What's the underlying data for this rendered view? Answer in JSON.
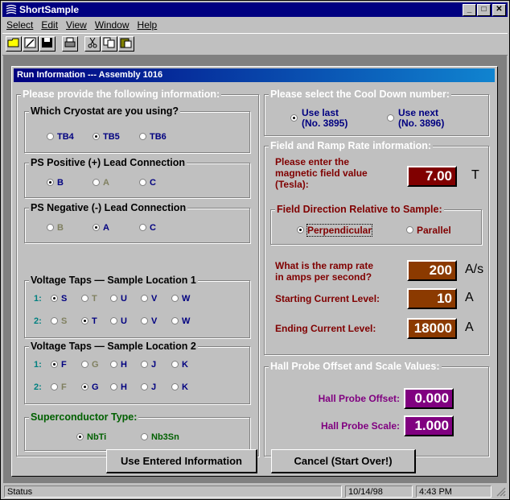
{
  "app": {
    "title": "ShortSample",
    "min_btn": "_",
    "max_btn": "□",
    "close_btn": "✕"
  },
  "menu": {
    "items": [
      "Select",
      "Edit",
      "View",
      "Window",
      "Help"
    ]
  },
  "toolbar": {
    "icons": [
      "open-folder-icon",
      "edit-icon",
      "save-icon",
      "print-icon",
      "cut-icon",
      "copy-icon",
      "paste-icon"
    ]
  },
  "dialog": {
    "title": "Run Information --- Assembly 1016",
    "left_header": "Please provide the following information:",
    "cryostat": {
      "label": "Which Cryostat are you using?",
      "options": [
        "TB4",
        "TB5",
        "TB6"
      ],
      "selected": "TB5"
    },
    "ps_positive": {
      "label": "PS Positive (+) Lead Connection",
      "options": [
        "B",
        "A",
        "C"
      ],
      "selected": "B"
    },
    "ps_negative": {
      "label": "PS Negative (-) Lead Connection",
      "options": [
        "B",
        "A",
        "C"
      ],
      "selected": "A"
    },
    "voltage_taps_1": {
      "label": "Voltage Taps — Sample Location 1",
      "row1_label": "1:",
      "row1_options": [
        "S",
        "T",
        "U",
        "V",
        "W"
      ],
      "row1_selected": "S",
      "row2_label": "2:",
      "row2_options": [
        "S",
        "T",
        "U",
        "V",
        "W"
      ],
      "row2_selected": "T"
    },
    "voltage_taps_2": {
      "label": "Voltage Taps — Sample Location 2",
      "row1_label": "1:",
      "row1_options": [
        "F",
        "G",
        "H",
        "J",
        "K"
      ],
      "row1_selected": "F",
      "row2_label": "2:",
      "row2_options": [
        "F",
        "G",
        "H",
        "J",
        "K"
      ],
      "row2_selected": "G"
    },
    "superconductor": {
      "label": "Superconductor Type:",
      "options": [
        "NbTi",
        "Nb3Sn"
      ],
      "selected": "NbTi"
    },
    "cooldown": {
      "label": "Please select the Cool Down number:",
      "option1_line1": "Use last",
      "option1_line2": "(No. 3895)",
      "option2_line1": "Use next",
      "option2_line2": "(No. 3896)",
      "selected": "last"
    },
    "field_ramp": {
      "label": "Field and Ramp Rate information:",
      "field_prompt_1": "Please enter the",
      "field_prompt_2": "magnetic field value",
      "field_prompt_3": "(Tesla):",
      "field_value": "7.00",
      "field_unit": "T",
      "direction_label": "Field Direction Relative to Sample:",
      "direction_options": [
        "Perpendicular",
        "Parallel"
      ],
      "direction_selected": "Perpendicular",
      "ramp_prompt_1": "What is the ramp rate",
      "ramp_prompt_2": "in amps per second?",
      "ramp_value": "200",
      "ramp_unit": "A/s",
      "start_label": "Starting Current Level:",
      "start_value": "10",
      "start_unit": "A",
      "end_label": "Ending Current Level:",
      "end_value": "18000",
      "end_unit": "A"
    },
    "hall": {
      "label": "Hall Probe Offset and Scale Values:",
      "offset_label": "Hall Probe Offset:",
      "offset_value": "0.000",
      "scale_label": "Hall Probe Scale:",
      "scale_value": "1.000"
    },
    "buttons": {
      "use": "Use Entered Information",
      "cancel": "Cancel  (Start Over!)"
    }
  },
  "status": {
    "text": "Status",
    "date": "10/14/98",
    "time": "4:43 PM"
  }
}
